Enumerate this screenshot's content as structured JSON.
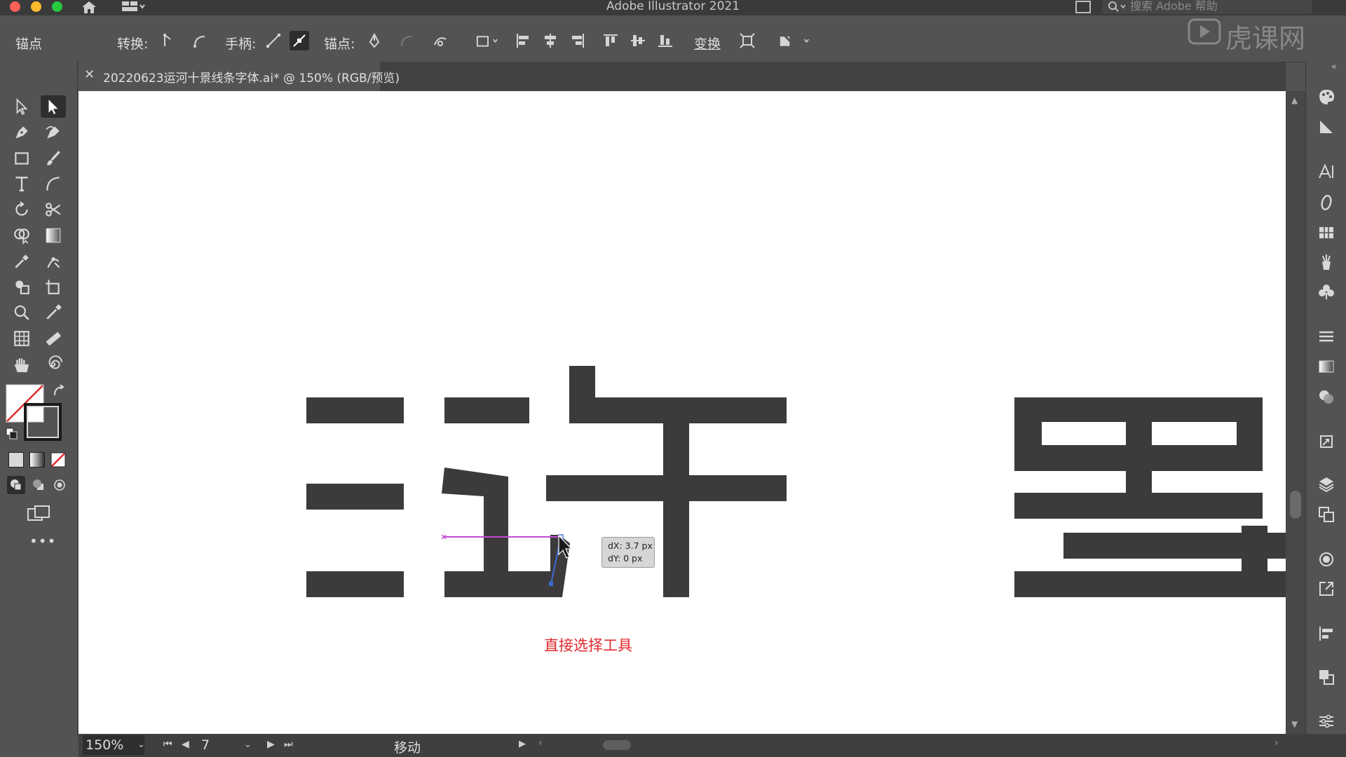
{
  "window": {
    "title": "Adobe Illustrator 2021",
    "search_placeholder": "搜索 Adobe 帮助"
  },
  "watermark": {
    "text": "虎课网"
  },
  "control_bar": {
    "selection_label": "锚点",
    "convert_label": "转换:",
    "handles_label": "手柄:",
    "anchors_label": "锚点:",
    "transform_label": "变换"
  },
  "document_tab": {
    "title": "20220623运河十景线条字体.ai* @ 150% (RGB/预览)"
  },
  "canvas": {
    "tooltip_dx": "dX: 3.7 px",
    "tooltip_dy": "dY: 0 px",
    "annotation": "直接选择工具"
  },
  "status_bar": {
    "zoom": "150%",
    "artboard_number": "7",
    "status": "移动"
  },
  "colors": {
    "glyph": "#3d3a3b",
    "annotation": "#e0282e",
    "path_selection": "#c34ad0",
    "handle": "#3c6bd6"
  }
}
